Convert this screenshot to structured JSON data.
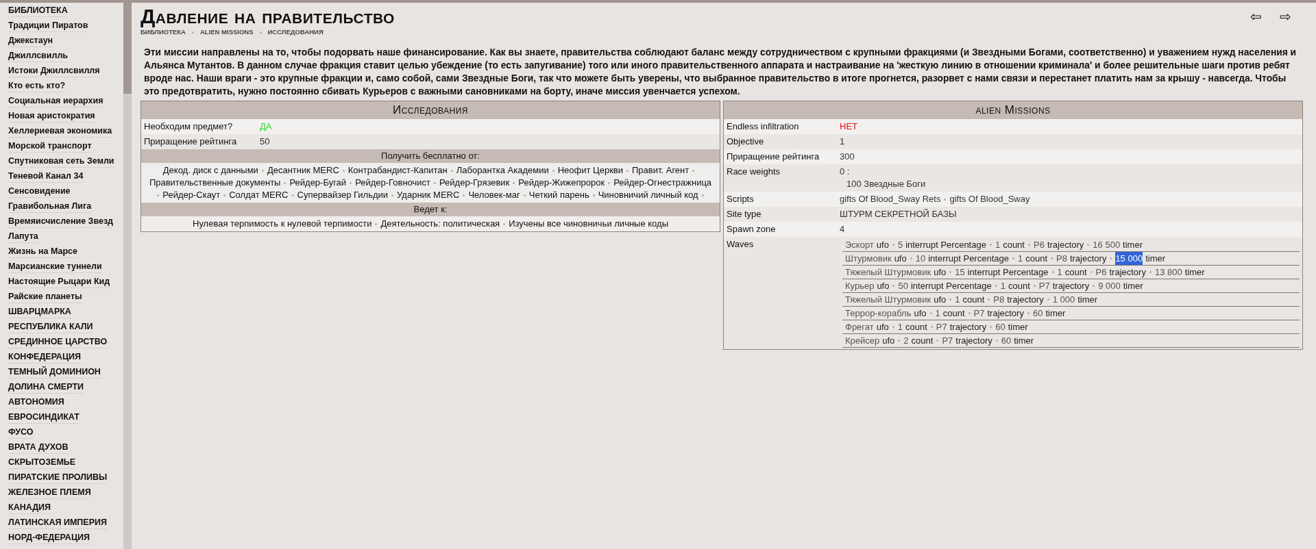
{
  "sidebar": {
    "items": [
      {
        "label": "БИБЛИОТЕКА"
      },
      {
        "label": "Традиции Пиратов"
      },
      {
        "label": "Джекстаун"
      },
      {
        "label": "Джиллсвилль"
      },
      {
        "label": "Истоки Джиллсвилля"
      },
      {
        "label": "Кто есть кто?"
      },
      {
        "label": "Социальная иерархия"
      },
      {
        "label": "Новая аристократия"
      },
      {
        "label": "Хеллериевая экономика"
      },
      {
        "label": "Морской транспорт"
      },
      {
        "label": "Спутниковая сеть Земли"
      },
      {
        "label": "Теневой Канал 34"
      },
      {
        "label": "Сенсовидение"
      },
      {
        "label": "Гравибольная Лига"
      },
      {
        "label": "Времяисчисление Звезд"
      },
      {
        "label": "Лапута"
      },
      {
        "label": "Жизнь на Марсе"
      },
      {
        "label": "Марсианские туннели"
      },
      {
        "label": "Настоящие Рыцари Кид"
      },
      {
        "label": "Райские планеты"
      },
      {
        "label": "ШВАРЦМАРКА"
      },
      {
        "label": "РЕСПУБЛИКА КАЛИ"
      },
      {
        "label": "СРЕДИННОЕ ЦАРСТВО"
      },
      {
        "label": "КОНФЕДЕРАЦИЯ"
      },
      {
        "label": "ТЕМНЫЙ ДОМИНИОН"
      },
      {
        "label": "ДОЛИНА СМЕРТИ"
      },
      {
        "label": "АВТОНОМИЯ"
      },
      {
        "label": "ЕВРОСИНДИКАТ"
      },
      {
        "label": "ФУСО"
      },
      {
        "label": "ВРАТА ДУХОВ"
      },
      {
        "label": "СКРЫТОЗЕМЬЕ"
      },
      {
        "label": "ПИРАТСКИЕ ПРОЛИВЫ"
      },
      {
        "label": "ЖЕЛЕЗНОЕ ПЛЕМЯ"
      },
      {
        "label": "КАНАДИЯ"
      },
      {
        "label": "ЛАТИНСКАЯ ИМПЕРИЯ"
      },
      {
        "label": "НОРД-ФЕДЕРАЦИЯ"
      }
    ]
  },
  "title": "Давление на правительство",
  "breadcrumb": [
    "БИБЛИОТЕКА",
    "ALIEN MISSIONS",
    "ИССЛЕДОВАНИЯ"
  ],
  "nav": [
    "⇦",
    "⇨"
  ],
  "description": "Эти миссии направлены на то, чтобы подорвать наше финансирование. Как вы знаете, правительства соблюдают баланс между сотрудничеством с крупными фракциями (и Звездными Богами, соответственно) и уважением нужд населения и Альянса Мутантов. В данном случае фракция ставит целью убеждение (то есть запугивание) того или иного правительственного аппарата и настраивание на 'жесткую линию в отношении криминала' и более решительные шаги против ребят вроде нас. Наши враги - это крупные фракции и, само собой, сами Звездные Боги, так что можете быть уверены, что выбранное правительство в итоге прогнется, разорвет с нами связи и перестанет платить нам за крышу - навсегда. Чтобы это предотвратить, нужно постоянно сбивать Курьеров с важными сановниками на борту, иначе миссия увенчается успехом.",
  "research": {
    "title": "Исследования",
    "rows": [
      {
        "label": "Необходим предмет?",
        "value": "ДА",
        "kind": "yes"
      },
      {
        "label": "Приращение рейтинга",
        "value": "50",
        "kind": "plain"
      }
    ],
    "sections": [
      {
        "heading": "Получить бесплатно от:",
        "links": [
          "Декод. диск с данными",
          "Десантник MERC",
          "Контрабандист-Капитан",
          "Лаборантка Академии",
          "Неофит Церкви",
          "Правит. Агент",
          "Правительственные документы",
          "Рейдер-Бугай",
          "Рейдер-Говночист",
          "Рейдер-Грязевик",
          "Рейдер-Жижепророк",
          "Рейдер-Огнестражница",
          "Рейдер-Скаут",
          "Солдат MERC",
          "Супервайзер Гильдии",
          "Ударник MERC",
          "Человек-маг",
          "Четкий парень",
          "Чиновничий личный код"
        ]
      },
      {
        "heading": "Ведет к:",
        "links": [
          "Нулевая терпимость к нулевой терпимости",
          "Деятельность: политическая",
          "Изучены все чиновничьи личные коды"
        ]
      }
    ]
  },
  "missions": {
    "title": "alien Missions",
    "rows": [
      {
        "label": "Endless infiltration",
        "kind": "no",
        "value": "НЕТ"
      },
      {
        "label": "Objective",
        "kind": "plain",
        "value": "1"
      },
      {
        "label": "Приращение рейтинга",
        "kind": "plain",
        "value": "300"
      },
      {
        "label": "Race weights",
        "kind": "weights",
        "value": "0 :",
        "sub": "100 Звездные Боги"
      },
      {
        "label": "Scripts",
        "kind": "links",
        "links": [
          "gifts Of Blood_Sway Rets",
          "gifts Of Blood_Sway"
        ]
      },
      {
        "label": "Site type",
        "kind": "plain",
        "value": "ШТУРМ СЕКРЕТНОЙ БАЗЫ"
      },
      {
        "label": "Spawn zone",
        "kind": "plain",
        "value": "4"
      },
      {
        "label": "Waves",
        "kind": "waves",
        "waves": [
          [
            {
              "value": "Эскорт",
              "key": "ufo",
              "selected": false
            },
            {
              "value": "5",
              "key": "interrupt Percentage",
              "selected": false
            },
            {
              "value": "1",
              "key": "count",
              "selected": false
            },
            {
              "value": "P6",
              "key": "trajectory",
              "selected": false
            },
            {
              "value": "16 500",
              "key": "timer",
              "selected": false
            }
          ],
          [
            {
              "value": "Штурмовик",
              "key": "ufo",
              "selected": false
            },
            {
              "value": "10",
              "key": "interrupt Percentage",
              "selected": false
            },
            {
              "value": "1",
              "key": "count",
              "selected": false
            },
            {
              "value": "P8",
              "key": "trajectory",
              "selected": false
            },
            {
              "value": "15 000",
              "key": "timer",
              "selected": true
            }
          ],
          [
            {
              "value": "Тяжелый Штурмовик",
              "key": "ufo",
              "selected": false
            },
            {
              "value": "15",
              "key": "interrupt Percentage",
              "selected": false
            },
            {
              "value": "1",
              "key": "count",
              "selected": false
            },
            {
              "value": "P6",
              "key": "trajectory",
              "selected": false
            },
            {
              "value": "13 800",
              "key": "timer",
              "selected": false
            }
          ],
          [
            {
              "value": "Курьер",
              "key": "ufo",
              "selected": false
            },
            {
              "value": "50",
              "key": "interrupt Percentage",
              "selected": false
            },
            {
              "value": "1",
              "key": "count",
              "selected": false
            },
            {
              "value": "P7",
              "key": "trajectory",
              "selected": false
            },
            {
              "value": "9 000",
              "key": "timer",
              "selected": false
            }
          ],
          [
            {
              "value": "Тяжелый Штурмовик",
              "key": "ufo",
              "selected": false
            },
            {
              "value": "1",
              "key": "count",
              "selected": false
            },
            {
              "value": "P8",
              "key": "trajectory",
              "selected": false
            },
            {
              "value": "1 000",
              "key": "timer",
              "selected": false
            }
          ],
          [
            {
              "value": "Террор-корабль",
              "key": "ufo",
              "selected": false
            },
            {
              "value": "1",
              "key": "count",
              "selected": false
            },
            {
              "value": "P7",
              "key": "trajectory",
              "selected": false
            },
            {
              "value": "60",
              "key": "timer",
              "selected": false
            }
          ],
          [
            {
              "value": "Фрегат",
              "key": "ufo",
              "selected": false
            },
            {
              "value": "1",
              "key": "count",
              "selected": false
            },
            {
              "value": "P7",
              "key": "trajectory",
              "selected": false
            },
            {
              "value": "60",
              "key": "timer",
              "selected": false
            }
          ],
          [
            {
              "value": "Крейсер",
              "key": "ufo",
              "selected": false
            },
            {
              "value": "2",
              "key": "count",
              "selected": false
            },
            {
              "value": "P7",
              "key": "trajectory",
              "selected": false
            },
            {
              "value": "60",
              "key": "timer",
              "selected": false
            }
          ]
        ]
      }
    ]
  }
}
